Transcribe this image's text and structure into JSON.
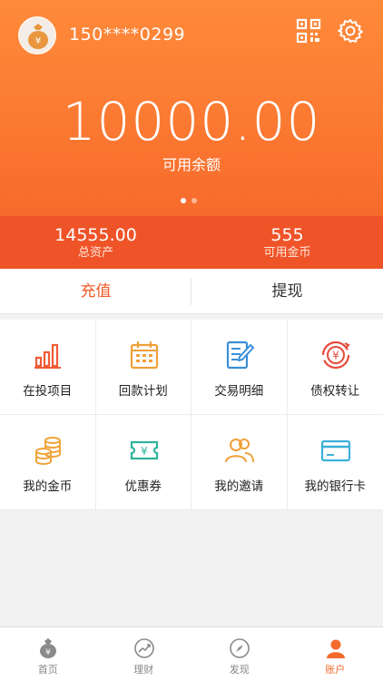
{
  "header": {
    "phone": "150****0299",
    "balance": "10000.00",
    "balance_label": "可用余额"
  },
  "stats": [
    {
      "value": "14555.00",
      "label": "总资产"
    },
    {
      "value": "555",
      "label": "可用金币"
    }
  ],
  "actions": {
    "recharge": "充值",
    "withdraw": "提现"
  },
  "grid": [
    {
      "label": "在投项目",
      "icon": "bar-chart-icon"
    },
    {
      "label": "回款计划",
      "icon": "calendar-icon"
    },
    {
      "label": "交易明细",
      "icon": "document-edit-icon"
    },
    {
      "label": "债权转让",
      "icon": "yuan-transfer-icon"
    },
    {
      "label": "我的金币",
      "icon": "coins-icon"
    },
    {
      "label": "优惠券",
      "icon": "coupon-icon"
    },
    {
      "label": "我的邀请",
      "icon": "users-icon"
    },
    {
      "label": "我的银行卡",
      "icon": "bank-card-icon"
    }
  ],
  "tabbar": [
    {
      "label": "首页",
      "icon": "money-bag-icon"
    },
    {
      "label": "理财",
      "icon": "chart-up-icon"
    },
    {
      "label": "发现",
      "icon": "compass-icon"
    },
    {
      "label": "账户",
      "icon": "person-icon",
      "active": true
    }
  ],
  "colors": {
    "brand_orange": "#f77a34",
    "stats_red": "#ef5429",
    "active_tab": "#f26b2c"
  }
}
